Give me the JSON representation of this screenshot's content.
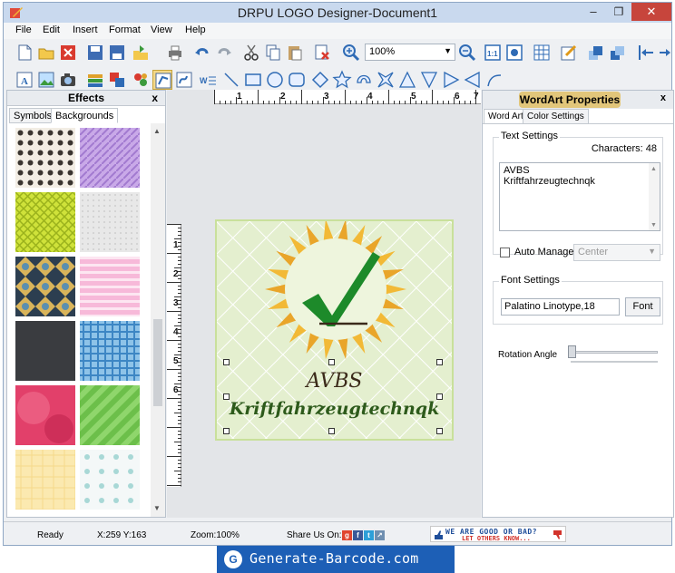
{
  "window": {
    "title": "DRPU LOGO Designer-Document1"
  },
  "menu": [
    "File",
    "Edit",
    "Insert",
    "Format",
    "View",
    "Help"
  ],
  "toolbar": {
    "zoom_value": "100%"
  },
  "effects_panel": {
    "title": "Effects",
    "tabs": [
      "Symbols",
      "Backgrounds"
    ],
    "active_tab": "Backgrounds"
  },
  "ruler": {
    "h_numbers": [
      "1",
      "2",
      "3",
      "4",
      "5",
      "6",
      "7"
    ],
    "v_numbers": [
      "1",
      "2",
      "3",
      "4",
      "5",
      "6"
    ]
  },
  "logo": {
    "line1": "AVBS",
    "line2": "Kriftfahrzeugtechnqk"
  },
  "wordart": {
    "title": "WordArt Properties",
    "tabs": [
      "Word Art",
      "Color Settings"
    ],
    "active_tab": "Word Art",
    "text_settings_label": "Text Settings",
    "characters_label": "Characters: 48",
    "text_lines": [
      "AVBS",
      "Kriftfahrzeugtechnqk"
    ],
    "auto_manage_label": "Auto Manage",
    "alignment": "Center",
    "font_settings_label": "Font Settings",
    "font_value": "Palatino Linotype,18",
    "font_button": "Font",
    "rotation_label": "Rotation Angle"
  },
  "status": {
    "ready": "Ready",
    "coords": "X:259  Y:163",
    "zoom": "Zoom:100%",
    "share": "Share Us On:",
    "feedback_line1": "WE ARE GOOD OR BAD?",
    "feedback_line2": "LET OTHERS KNOW..."
  },
  "banner": {
    "text": "Generate-Barcode.com"
  }
}
